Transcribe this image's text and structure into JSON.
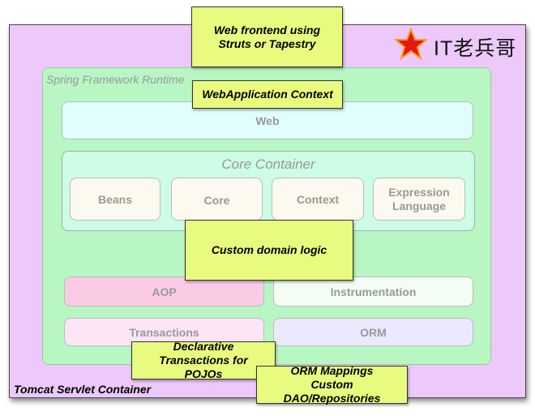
{
  "container": {
    "label": "Tomcat Servlet Container"
  },
  "runtime": {
    "label": "Spring Framework Runtime"
  },
  "web": {
    "label": "Web"
  },
  "core": {
    "label": "Core Container",
    "modules": [
      "Beans",
      "Core",
      "Context",
      "Expression Language"
    ]
  },
  "aop": {
    "label": "AOP"
  },
  "instrumentation": {
    "label": "Instrumentation"
  },
  "transactions": {
    "label": "Transactions"
  },
  "orm": {
    "label": "ORM"
  },
  "notes": {
    "web_frontend": "Web frontend  using Struts or Tapestry",
    "webapp_context": "WebApplication Context",
    "domain_logic": "Custom domain logic",
    "declarative_tx": "Declarative Transactions for POJOs",
    "orm_mappings": "ORM Mappings Custom DAO/Repositories"
  },
  "watermark": {
    "text": "IT老兵哥",
    "icon": "red-star-icon"
  }
}
